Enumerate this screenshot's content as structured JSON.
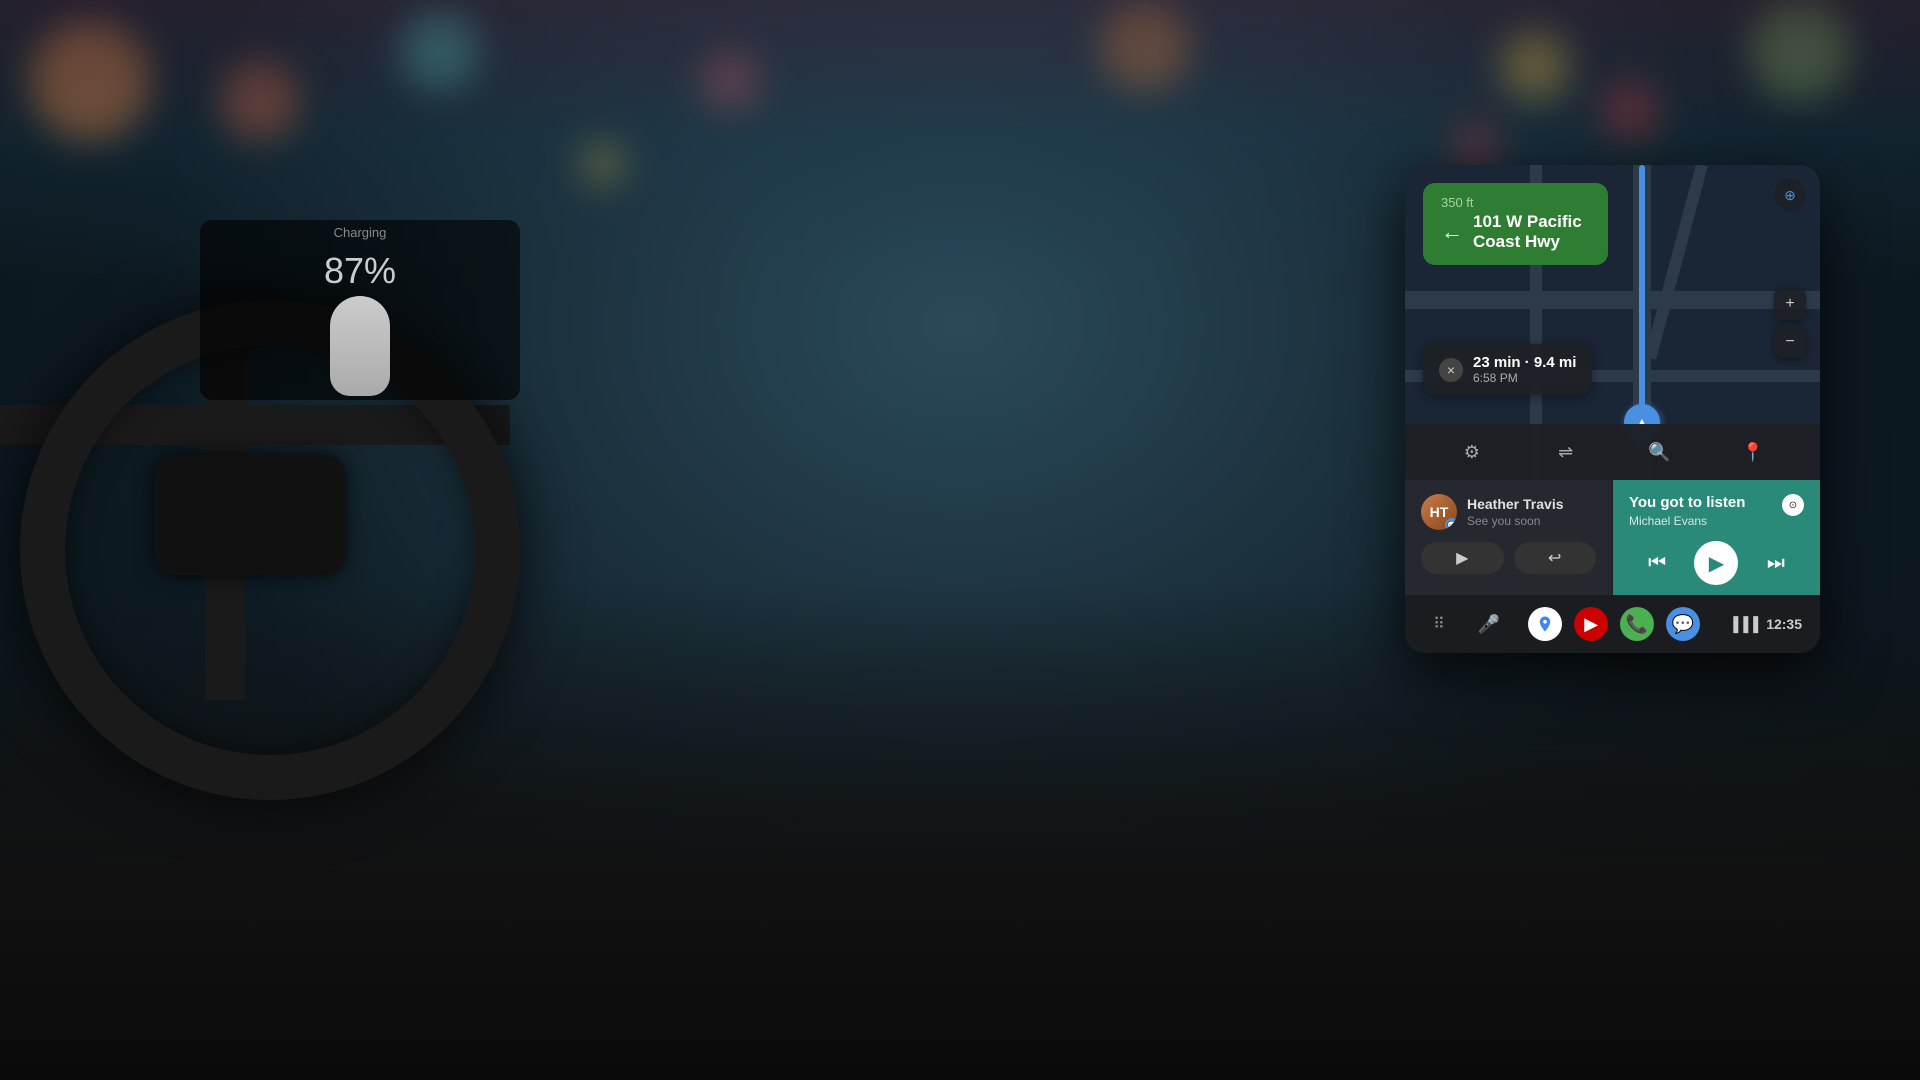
{
  "background": {
    "color_top": "#1a3040",
    "color_mid": "#0d1a22"
  },
  "instrument": {
    "charge_percent": "87%",
    "charge_label": "Charging"
  },
  "navigation": {
    "distance": "350 ft",
    "street_line1": "101 W Pacific",
    "street_line2": "Coast Hwy",
    "eta_duration": "23 min · 9.4 mi",
    "eta_arrival": "6:58 PM",
    "close_label": "×"
  },
  "map_actions": {
    "settings_icon": "⚙",
    "routes_icon": "⇌",
    "search_icon": "🔍",
    "pin_icon": "📍",
    "zoom_in": "+",
    "zoom_out": "−",
    "location_icon": "⊕"
  },
  "message": {
    "sender_name": "Heather Travis",
    "preview": "See you soon",
    "avatar_initials": "HT",
    "play_label": "▶",
    "reply_label": "↩",
    "msg_icon": "💬"
  },
  "music": {
    "title": "You got to listen",
    "artist": "Michael Evans",
    "service_icon": "♪",
    "prev_icon": "⏮",
    "play_icon": "▶",
    "next_icon": "⏭",
    "cast_icon": "⊙"
  },
  "bottom_nav": {
    "apps_icon": "⠿",
    "mic_icon": "🎤",
    "time": "12:35",
    "signal_icon": "▐▐▐"
  }
}
